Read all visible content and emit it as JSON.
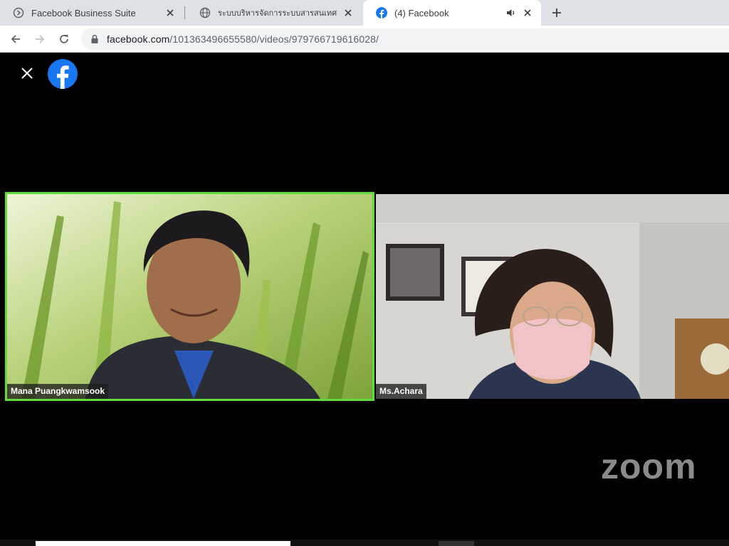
{
  "browser": {
    "tabs": [
      {
        "title": "Facebook Business Suite",
        "icon": "business-suite-icon"
      },
      {
        "title": "ระบบบริหารจัดการระบบสารสนเทศ มหา",
        "icon": "globe-icon"
      },
      {
        "title": "(4) Facebook",
        "icon": "facebook-icon",
        "active": true,
        "audio": true
      }
    ],
    "url": {
      "host": "facebook.com",
      "path": "/101363496655580/videos/979766719616028/"
    }
  },
  "video": {
    "participants": [
      {
        "name": "Mana Puangkwamsook",
        "active_speaker": true
      },
      {
        "name": "Ms.Achara",
        "active_speaker": false
      }
    ],
    "watermark": "zoom",
    "progress": 0.35
  },
  "colors": {
    "speaker_border": "#5fdc3c",
    "facebook_blue": "#1877f2",
    "tab_strip": "#dee1e6"
  }
}
